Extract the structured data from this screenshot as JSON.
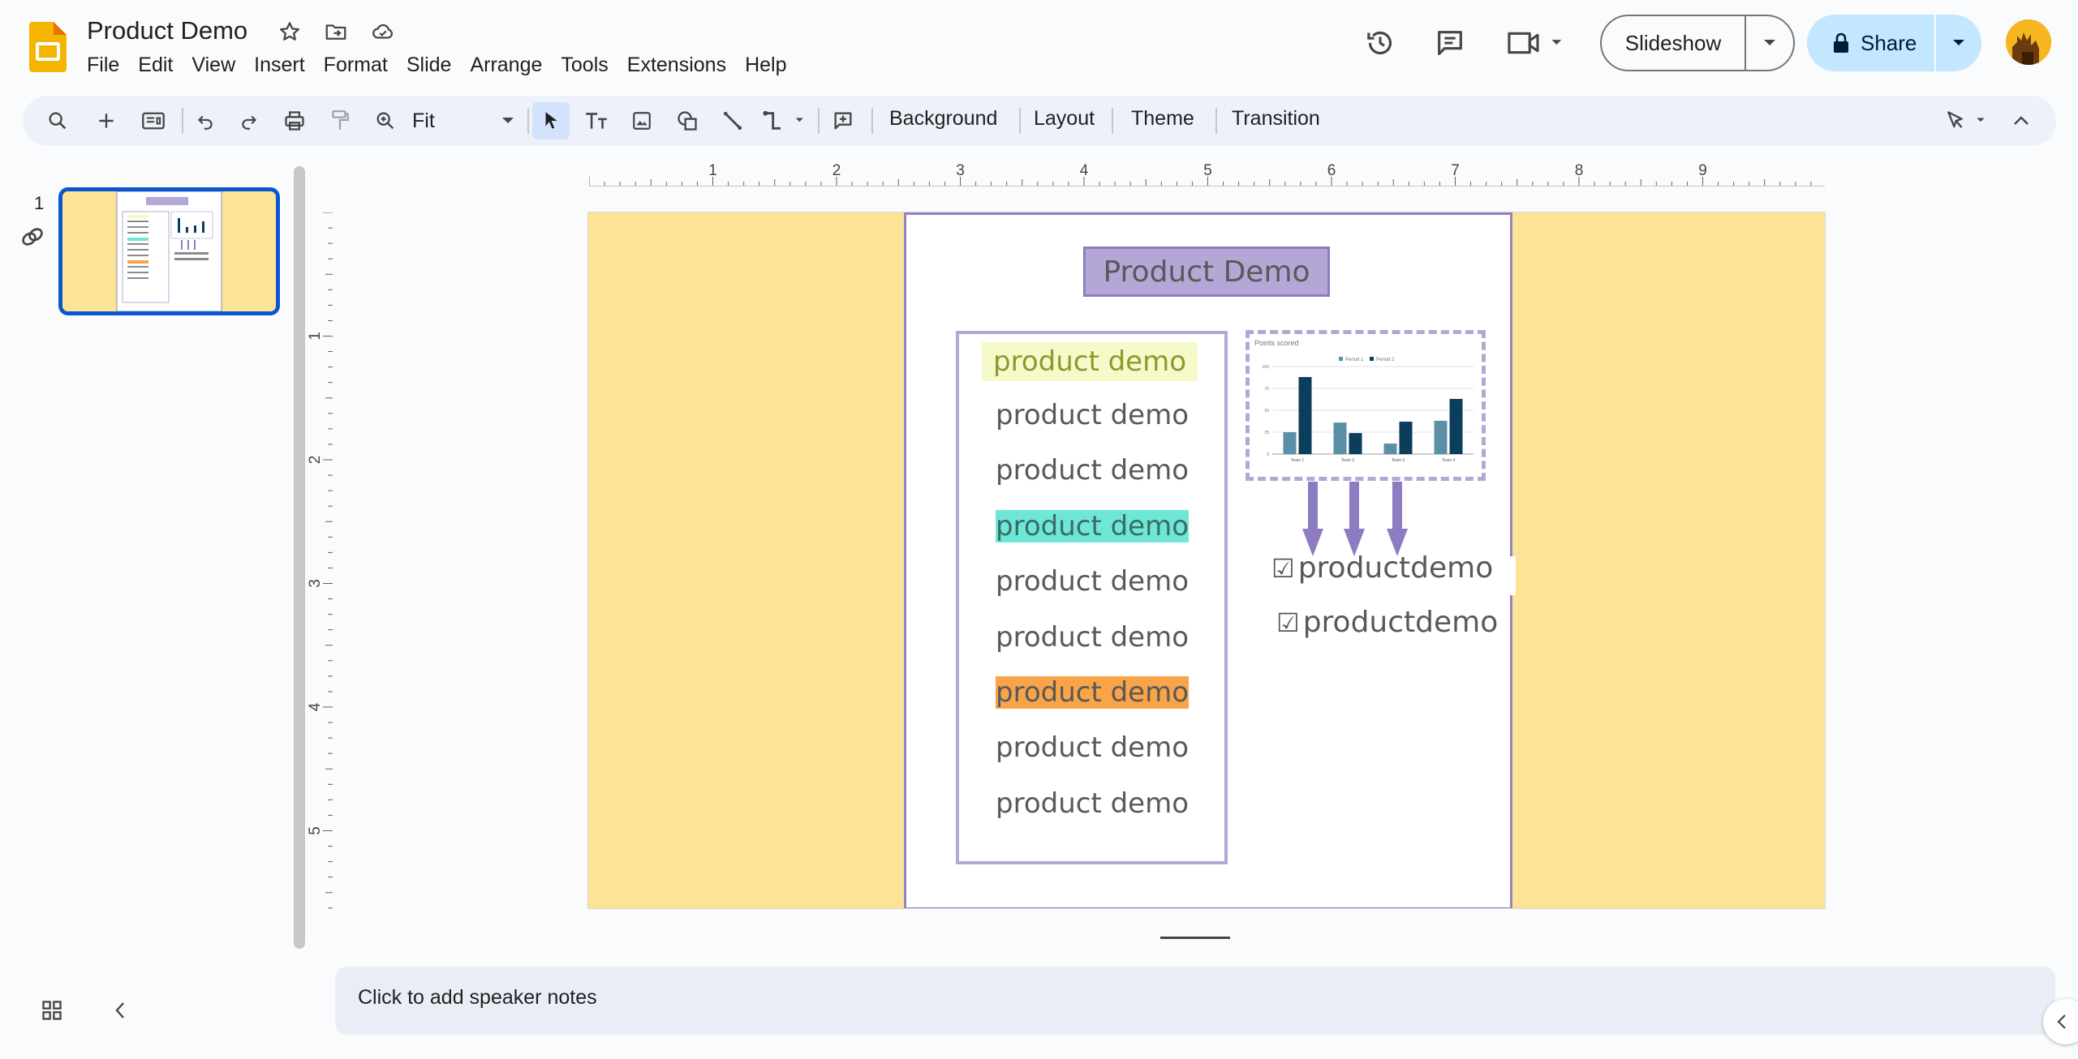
{
  "app": {
    "title": "Product Demo",
    "menu": [
      "File",
      "Edit",
      "View",
      "Insert",
      "Format",
      "Slide",
      "Arrange",
      "Tools",
      "Extensions",
      "Help"
    ],
    "slideshow_label": "Slideshow",
    "share_label": "Share"
  },
  "toolbar": {
    "zoom": "Fit",
    "background_label": "Background",
    "layout_label": "Layout",
    "theme_label": "Theme",
    "transition_label": "Transition"
  },
  "filmstrip": {
    "slide_number": "1"
  },
  "ruler": {
    "horizontal": [
      "1",
      "2",
      "3",
      "4",
      "5",
      "6",
      "7",
      "8",
      "9"
    ],
    "vertical": [
      "1",
      "2",
      "3",
      "4",
      "5"
    ]
  },
  "slide": {
    "title": "Product Demo",
    "list": [
      {
        "text": "product demo",
        "highlight": "#f6f9c8",
        "color": "#8b9a2d"
      },
      {
        "text": "product demo",
        "highlight": "",
        "color": "#595959"
      },
      {
        "text": "product demo",
        "highlight": "",
        "color": "#595959"
      },
      {
        "text": "product demo",
        "highlight": "#6ee7d6",
        "color": "#3c6b66"
      },
      {
        "text": "product demo",
        "highlight": "",
        "color": "#595959"
      },
      {
        "text": "product demo",
        "highlight": "",
        "color": "#595959"
      },
      {
        "text": "product demo",
        "highlight": "#f9a448",
        "color": "#595959"
      },
      {
        "text": "product demo",
        "highlight": "",
        "color": "#595959"
      },
      {
        "text": "product demo",
        "highlight": "",
        "color": "#595959"
      }
    ],
    "checklist": [
      {
        "box": "☑",
        "text": "productdemo"
      },
      {
        "box": "☑",
        "text": "productdemo"
      }
    ],
    "colors": {
      "side_fill": "#fde396",
      "page_border": "#9085be",
      "title_fill": "#b4a7d6",
      "arrow": "#8e7cc3"
    }
  },
  "chart_data": {
    "type": "bar",
    "title": "Points scored",
    "categories": [
      "Team 1",
      "Team 2",
      "Team 3",
      "Team 4"
    ],
    "series": [
      {
        "name": "Period 1",
        "values": [
          25,
          36,
          12,
          38
        ],
        "color": "#5b8fa8"
      },
      {
        "name": "Period 2",
        "values": [
          88,
          24,
          37,
          63
        ],
        "color": "#0b3d5c"
      }
    ],
    "ylim": [
      0,
      100
    ],
    "yticks": [
      "0",
      "25",
      "50",
      "75",
      "100"
    ],
    "legend": "top",
    "grid": true
  },
  "notes": {
    "placeholder": "Click to add speaker notes"
  }
}
